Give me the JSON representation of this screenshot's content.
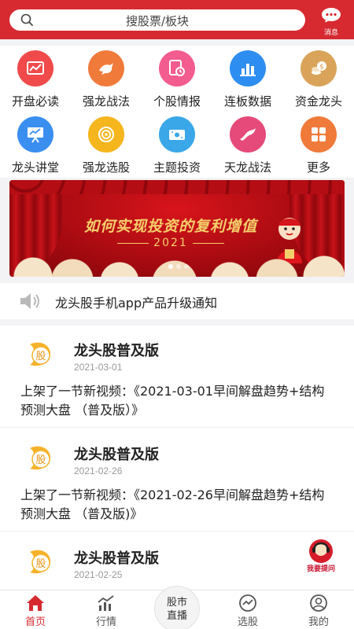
{
  "header": {
    "search_placeholder": "搜股票/板块",
    "message_label": "消息"
  },
  "grid": [
    {
      "label": "开盘必读",
      "icon": "chart-card-icon",
      "color": "#f04a4a"
    },
    {
      "label": "强龙战法",
      "icon": "dragon-icon",
      "color": "#f07a3a"
    },
    {
      "label": "个股情报",
      "icon": "clock-doc-icon",
      "color": "#f25c8e"
    },
    {
      "label": "连板数据",
      "icon": "bar-chart-icon",
      "color": "#2e8df0"
    },
    {
      "label": "资金龙头",
      "icon": "coins-icon",
      "color": "#d9a45a"
    },
    {
      "label": "龙头讲堂",
      "icon": "presentation-icon",
      "color": "#3a8ef0"
    },
    {
      "label": "强龙选股",
      "icon": "target-icon",
      "color": "#f5b51c"
    },
    {
      "label": "主题投资",
      "icon": "money-icon",
      "color": "#3aa7e8"
    },
    {
      "label": "天龙战法",
      "icon": "sky-dragon-icon",
      "color": "#e54a7a"
    },
    {
      "label": "更多",
      "icon": "more-grid-icon",
      "color": "#f07a3a"
    }
  ],
  "banner": {
    "title": "如何实现投资的复利增值",
    "year": "2021"
  },
  "notice": {
    "text": "龙头股手机app产品升级通知"
  },
  "feed": [
    {
      "name": "龙头股普及版",
      "date": "2021-03-01",
      "body": "上架了一节新视频：《2021-03-01早间解盘趋势+结构 预测大盘 （普及版）》"
    },
    {
      "name": "龙头股普及版",
      "date": "2021-02-26",
      "body": "上架了一节新视频：《2021-02-26早间解盘趋势+结构 预测大盘 （普及版)》"
    },
    {
      "name": "龙头股普及版",
      "date": "2021-02-25",
      "body": ""
    }
  ],
  "ask": {
    "label": "我要提问"
  },
  "tabbar": {
    "home": "首页",
    "market": "行情",
    "live_line1": "股市",
    "live_line2": "直播",
    "pick": "选股",
    "mine": "我的"
  },
  "colors": {
    "brand_red": "#d62a30",
    "active_tab": "#d62a30"
  }
}
